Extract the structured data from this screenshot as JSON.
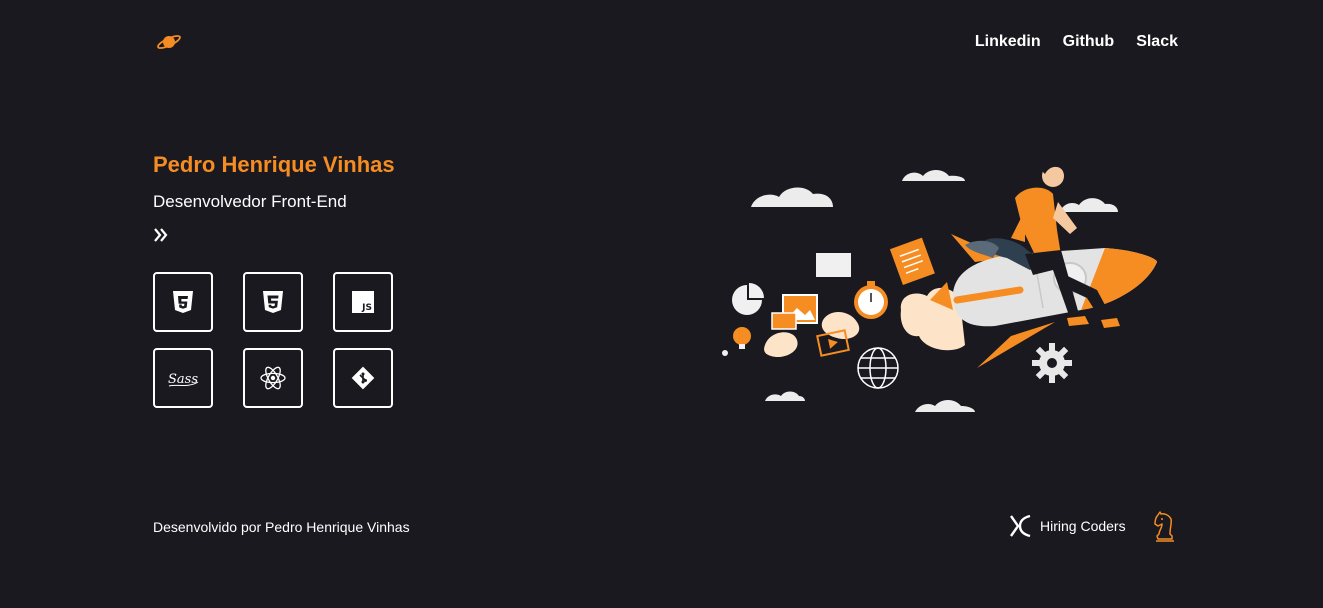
{
  "header": {
    "logo_icon": "planet-icon",
    "nav": [
      {
        "label": "Linkedin"
      },
      {
        "label": "Github"
      },
      {
        "label": "Slack"
      }
    ]
  },
  "hero": {
    "name": "Pedro Henrique Vinhas",
    "role": "Desenvolvedor Front-End",
    "arrow_icon": "double-chevron-right-icon",
    "skills": [
      {
        "icon": "html5-icon"
      },
      {
        "icon": "css3-icon"
      },
      {
        "icon": "javascript-icon"
      },
      {
        "icon": "sass-icon"
      },
      {
        "icon": "react-icon"
      },
      {
        "icon": "git-icon"
      }
    ],
    "illustration": "rocket-developer-illustration"
  },
  "footer": {
    "credit": "Desenvolvido por Pedro Henrique Vinhas",
    "hiring_label": "Hiring Coders",
    "hiring_icon": "hiring-coders-logo",
    "knight_icon": "chess-knight-icon"
  },
  "colors": {
    "background": "#1b1920",
    "accent": "#f58d22",
    "text": "#ffffff"
  }
}
